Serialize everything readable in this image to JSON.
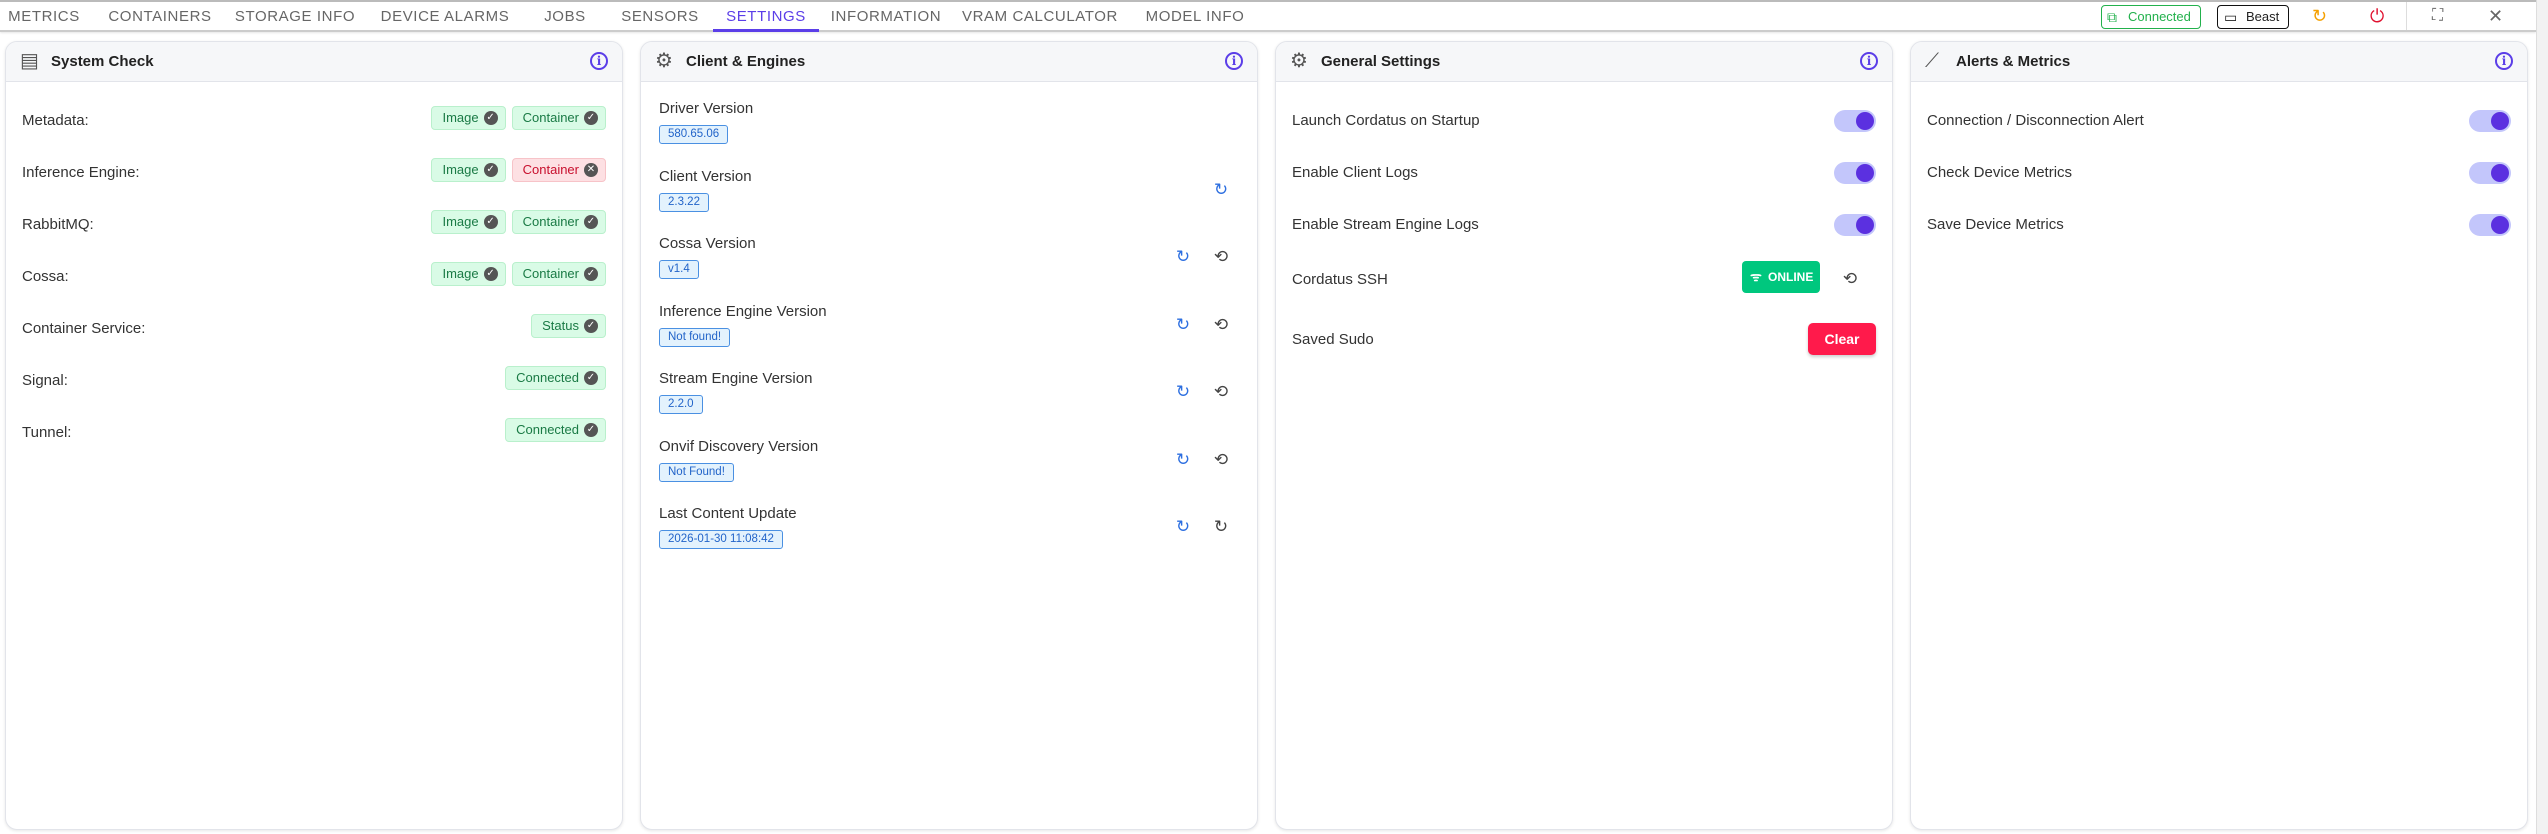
{
  "tabs": [
    "METRICS",
    "CONTAINERS",
    "STORAGE INFO",
    "DEVICE ALARMS",
    "JOBS",
    "SENSORS",
    "SETTINGS",
    "INFORMATION",
    "VRAM CALCULATOR",
    "MODEL INFO"
  ],
  "active_tab": "SETTINGS",
  "header": {
    "connection": "Connected",
    "device": "Beast"
  },
  "colors": {
    "accent": "#5b3ee8",
    "success": "#22b14c",
    "danger": "#ff1a4b",
    "online": "#00c77e"
  },
  "system_check": {
    "title": "System Check",
    "rows": [
      {
        "label": "Metadata:",
        "pills": [
          "Image",
          "Container"
        ]
      },
      {
        "label": "Inference Engine:",
        "pills": [
          "Image",
          "Container"
        ]
      },
      {
        "label": "RabbitMQ:",
        "pills": [
          "Image",
          "Container"
        ]
      },
      {
        "label": "Cossa:",
        "pills": [
          "Image",
          "Container"
        ]
      },
      {
        "label": "Container Service:",
        "pills": [
          "Status"
        ]
      },
      {
        "label": "Signal:",
        "pills": [
          "Connected"
        ]
      },
      {
        "label": "Tunnel:",
        "pills": [
          "Connected"
        ]
      }
    ]
  },
  "client_engines": {
    "title": "Client & Engines",
    "rows": [
      {
        "label": "Driver Version",
        "value": "580.65.06"
      },
      {
        "label": "Client Version",
        "value": "2.3.22"
      },
      {
        "label": "Cossa Version",
        "value": "v1.4"
      },
      {
        "label": "Inference Engine Version",
        "value": "Not found!"
      },
      {
        "label": "Stream Engine Version",
        "value": "2.2.0"
      },
      {
        "label": "Onvif Discovery Version",
        "value": "Not Found!"
      },
      {
        "label": "Last Content Update",
        "value": "2026-01-30 11:08:42"
      }
    ]
  },
  "general_settings": {
    "title": "General Settings",
    "toggles": [
      "Launch Cordatus on Startup",
      "Enable Client Logs",
      "Enable Stream Engine Logs"
    ],
    "ssh_label": "Cordatus SSH",
    "ssh_status": "ONLINE",
    "sudo_label": "Saved Sudo",
    "clear_label": "Clear"
  },
  "alerts_metrics": {
    "title": "Alerts & Metrics",
    "toggles": [
      "Connection / Disconnection Alert",
      "Check Device Metrics",
      "Save Device Metrics"
    ]
  }
}
